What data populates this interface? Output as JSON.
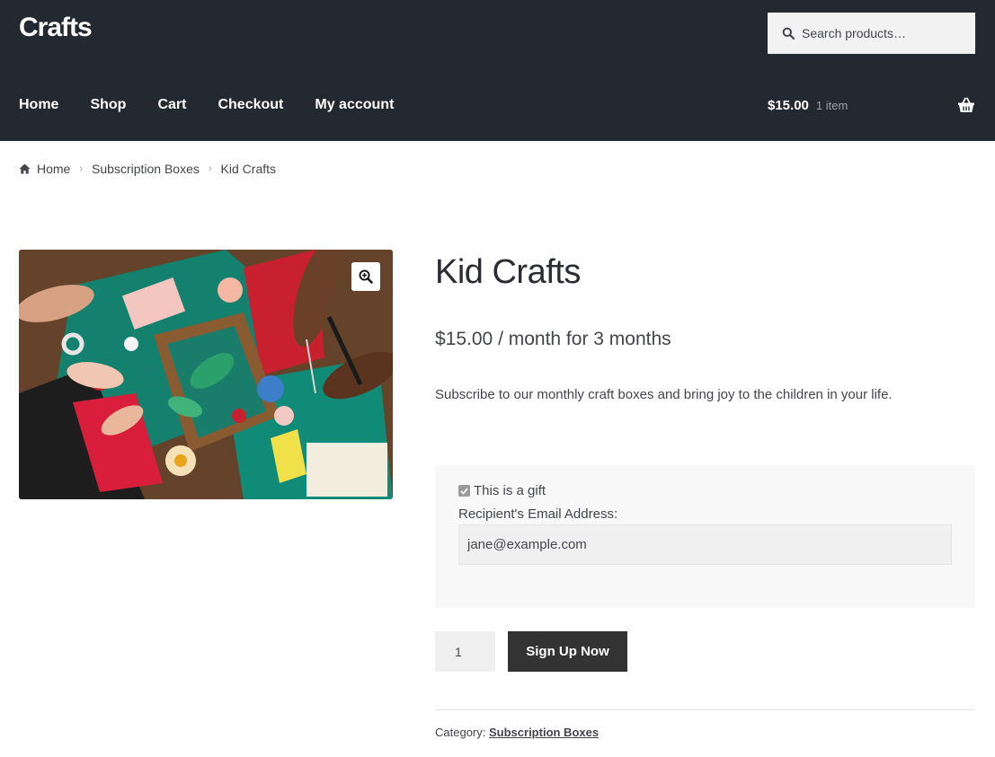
{
  "site": {
    "title": "Crafts"
  },
  "search": {
    "placeholder": "Search products…"
  },
  "nav": {
    "items": [
      {
        "label": "Home"
      },
      {
        "label": "Shop"
      },
      {
        "label": "Cart"
      },
      {
        "label": "Checkout"
      },
      {
        "label": "My account"
      }
    ]
  },
  "cart": {
    "amount": "$15.00",
    "count": "1 item",
    "icon": "basket-icon"
  },
  "breadcrumb": {
    "icon": "home-icon",
    "items": [
      "Home",
      "Subscription Boxes",
      "Kid Crafts"
    ]
  },
  "product": {
    "image_icon": "zoom-in-icon",
    "title": "Kid Crafts",
    "price": "$15.00 / month for 3 months",
    "description": "Subscribe to our monthly craft boxes and bring joy to the children in your life.",
    "gift": {
      "checkbox_label": "This is a gift",
      "checked": true,
      "email_label": "Recipient's Email Address:",
      "email_value": "jane@example.com"
    },
    "quantity": "1",
    "button_label": "Sign Up Now",
    "category_label": "Category:",
    "category_value": "Subscription Boxes"
  },
  "colors": {
    "header_bg": "#232931",
    "button_bg": "#333333",
    "gift_bg": "#f8f8f8"
  }
}
